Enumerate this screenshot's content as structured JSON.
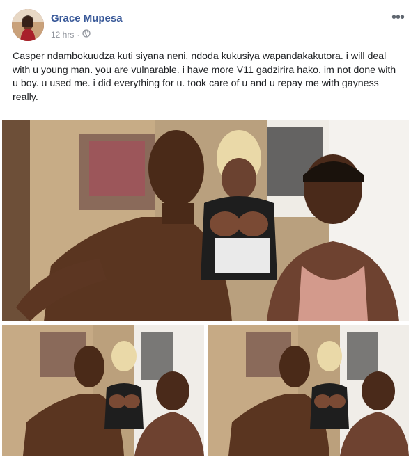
{
  "post": {
    "author_name": "Grace Mupesa",
    "timestamp": "12 hrs",
    "separator": "·",
    "privacy_icon": "globe-icon",
    "more_label": "•••",
    "text": "Casper ndambokuudza kuti siyana neni. ndoda kukusiya wapandakakutora. i will deal with u young man. you are vulnarable. i have more V11 gadzirira hako. im not done with u boy. u used me. i did everything for u. took care of u and u repay me with gayness really."
  },
  "photos": [
    {
      "name": "main-photo",
      "kind": "selfie"
    },
    {
      "name": "left-photo",
      "kind": "selfie"
    },
    {
      "name": "right-photo",
      "kind": "selfie"
    }
  ],
  "colors": {
    "author": "#385898",
    "meta": "#90949c",
    "text": "#1c1e21"
  }
}
